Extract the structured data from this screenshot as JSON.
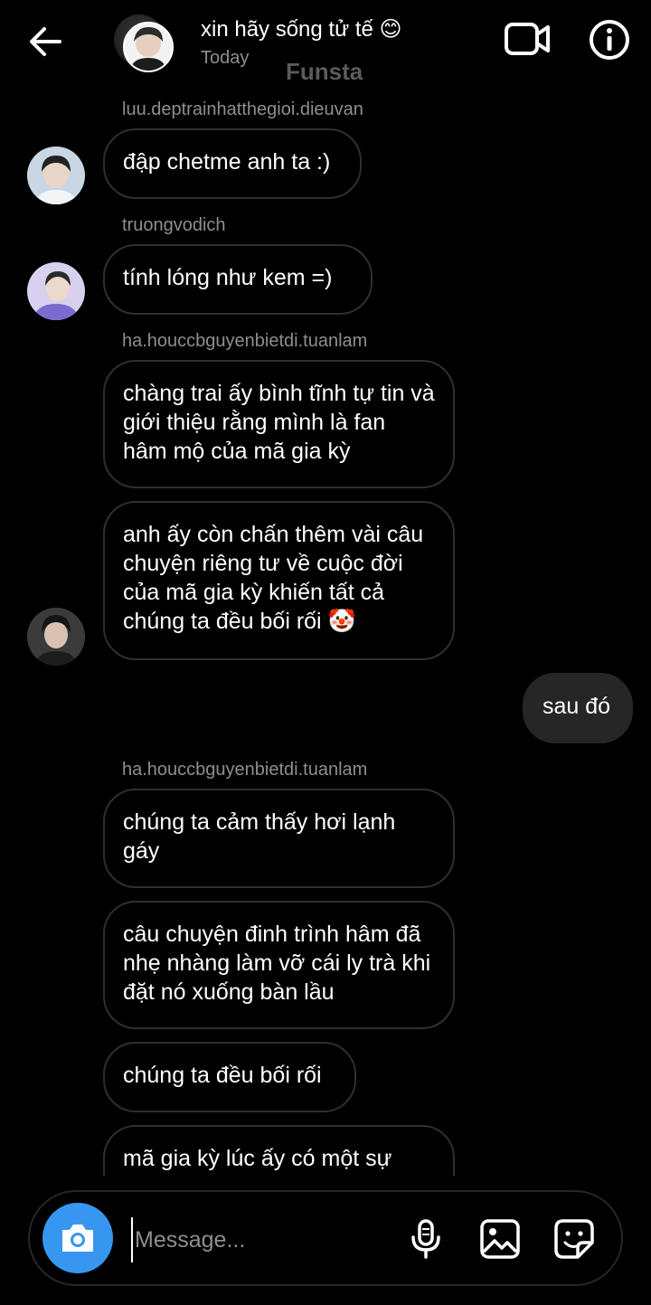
{
  "header": {
    "title": "xin hãy sống tử tế 😊",
    "subtitle": "Today",
    "watermark": "Funsta"
  },
  "messages": [
    {
      "sender": "luu.deptrainhatthegioi.dieuvan",
      "text": "đập chetme anh ta :)"
    },
    {
      "sender": "truongvodich",
      "text": "tính lóng như kem =)"
    },
    {
      "sender": "ha.houccbguyenbietdi.tuanlam",
      "text": "chàng trai ấy bình tĩnh tự tin và giới thiệu rằng mình là fan hâm mộ của mã gia kỳ"
    },
    {
      "text": "anh ấy còn chấn thêm vài câu chuyện riêng tư về cuộc đời của mã gia kỳ khiến tất cả chúng ta đều bối rối 🤡"
    },
    {
      "text": "sau đó",
      "mine": true
    },
    {
      "sender": "ha.houccbguyenbietdi.tuanlam",
      "text": "chúng ta cảm thấy hơi lạnh gáy"
    },
    {
      "text": "câu chuyện đinh trình hâm đã nhẹ nhàng làm vỡ cái ly trà khi đặt nó xuống bàn lầu"
    },
    {
      "text": "chúng ta đều bối rối"
    },
    {
      "text": "mã gia kỳ lúc ấy có một sự"
    }
  ],
  "composer": {
    "placeholder": "Message..."
  },
  "icons": {
    "back": "arrow-left-icon",
    "video": "video-camera-icon",
    "info": "info-icon",
    "camera": "camera-icon",
    "mic": "microphone-icon",
    "gallery": "image-icon",
    "sticker": "sticker-icon"
  },
  "colors": {
    "background": "#000000",
    "accent": "#3797f0",
    "my_bubble": "#262626",
    "bubble_border": "#2f2f2f",
    "muted_text": "#8e8e8e"
  }
}
